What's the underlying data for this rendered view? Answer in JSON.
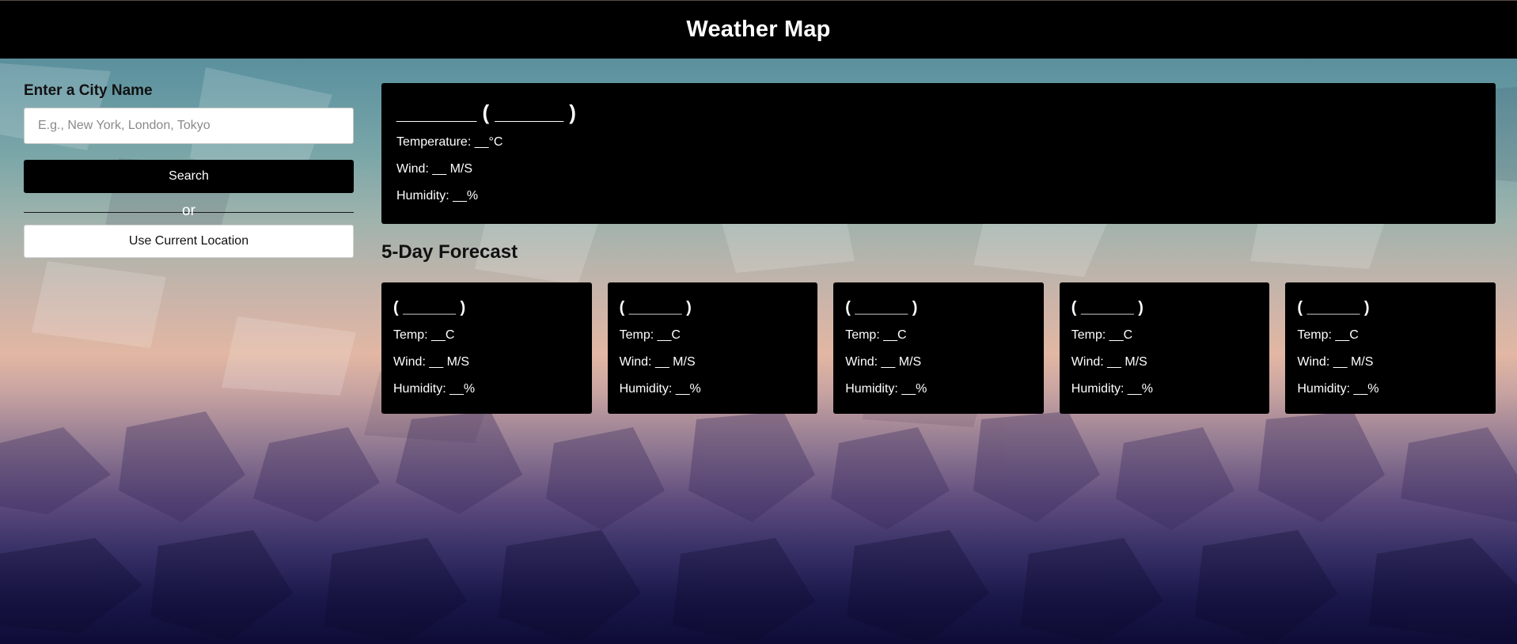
{
  "header": {
    "title": "Weather Map"
  },
  "search": {
    "label": "Enter a City Name",
    "placeholder": "E.g., New York, London, Tokyo",
    "value": "",
    "search_button": "Search",
    "or_text": "or",
    "location_button": "Use Current Location"
  },
  "current": {
    "city": "_______ ( ______ )",
    "temperature": "Temperature: __°C",
    "wind": "Wind: __ M/S",
    "humidity": "Humidity: __%"
  },
  "forecast": {
    "title": "5-Day Forecast",
    "days": [
      {
        "date": "( ______ )",
        "temp": "Temp: __C",
        "wind": "Wind: __ M/S",
        "humidity": "Humidity: __%"
      },
      {
        "date": "( ______ )",
        "temp": "Temp: __C",
        "wind": "Wind: __ M/S",
        "humidity": "Humidity: __%"
      },
      {
        "date": "( ______ )",
        "temp": "Temp: __C",
        "wind": "Wind: __ M/S",
        "humidity": "Humidity: __%"
      },
      {
        "date": "( ______ )",
        "temp": "Temp: __C",
        "wind": "Wind: __ M/S",
        "humidity": "Humidity: __%"
      },
      {
        "date": "( ______ )",
        "temp": "Temp: __C",
        "wind": "Wind: __ M/S",
        "humidity": "Humidity: __%"
      }
    ]
  },
  "colors": {
    "header_bg": "#000000",
    "card_bg": "#000000",
    "text_on_dark": "#ffffff"
  }
}
